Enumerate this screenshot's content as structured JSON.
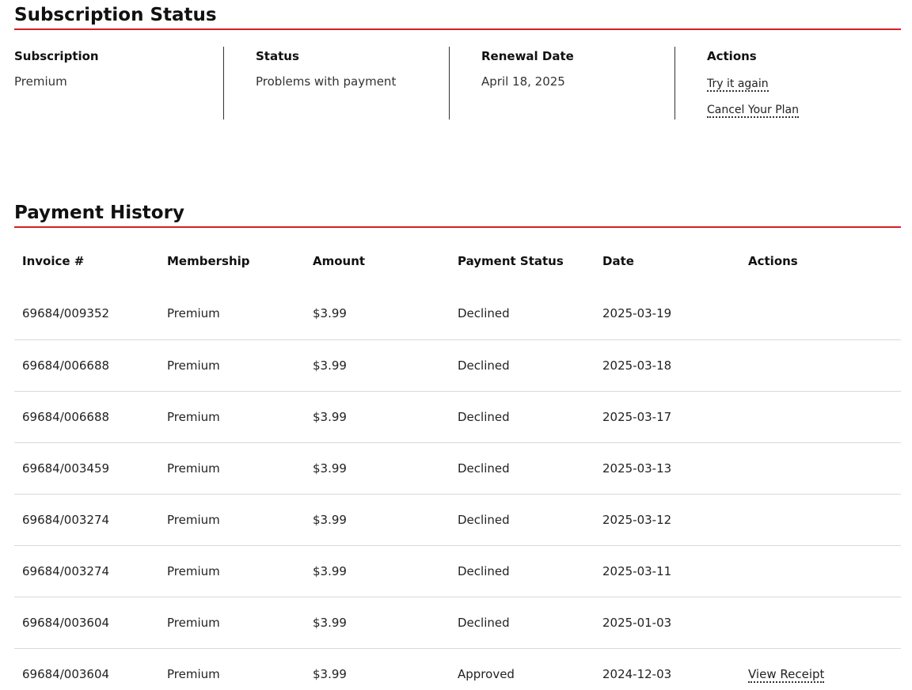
{
  "subscription": {
    "title": "Subscription Status",
    "columns": [
      {
        "header": "Subscription",
        "value": "Premium"
      },
      {
        "header": "Status",
        "value": "Problems with payment"
      },
      {
        "header": "Renewal Date",
        "value": "April 18, 2025"
      }
    ],
    "actions_header": "Actions",
    "actions": {
      "try_again": "Try it again",
      "cancel_plan": "Cancel Your Plan"
    }
  },
  "payment_history": {
    "title": "Payment History",
    "headers": [
      "Invoice #",
      "Membership",
      "Amount",
      "Payment Status",
      "Date",
      "Actions"
    ],
    "rows": [
      {
        "invoice": "69684/009352",
        "membership": "Premium",
        "amount": "$3.99",
        "status": "Declined",
        "date": "2025-03-19",
        "action": ""
      },
      {
        "invoice": "69684/006688",
        "membership": "Premium",
        "amount": "$3.99",
        "status": "Declined",
        "date": "2025-03-18",
        "action": ""
      },
      {
        "invoice": "69684/006688",
        "membership": "Premium",
        "amount": "$3.99",
        "status": "Declined",
        "date": "2025-03-17",
        "action": ""
      },
      {
        "invoice": "69684/003459",
        "membership": "Premium",
        "amount": "$3.99",
        "status": "Declined",
        "date": "2025-03-13",
        "action": ""
      },
      {
        "invoice": "69684/003274",
        "membership": "Premium",
        "amount": "$3.99",
        "status": "Declined",
        "date": "2025-03-12",
        "action": ""
      },
      {
        "invoice": "69684/003274",
        "membership": "Premium",
        "amount": "$3.99",
        "status": "Declined",
        "date": "2025-03-11",
        "action": ""
      },
      {
        "invoice": "69684/003604",
        "membership": "Premium",
        "amount": "$3.99",
        "status": "Declined",
        "date": "2025-01-03",
        "action": ""
      },
      {
        "invoice": "69684/003604",
        "membership": "Premium",
        "amount": "$3.99",
        "status": "Approved",
        "date": "2024-12-03",
        "action": "View Receipt"
      }
    ]
  },
  "colors": {
    "accent": "#d71f26",
    "row_divider": "#d9d9d9",
    "column_divider": "#333333"
  }
}
